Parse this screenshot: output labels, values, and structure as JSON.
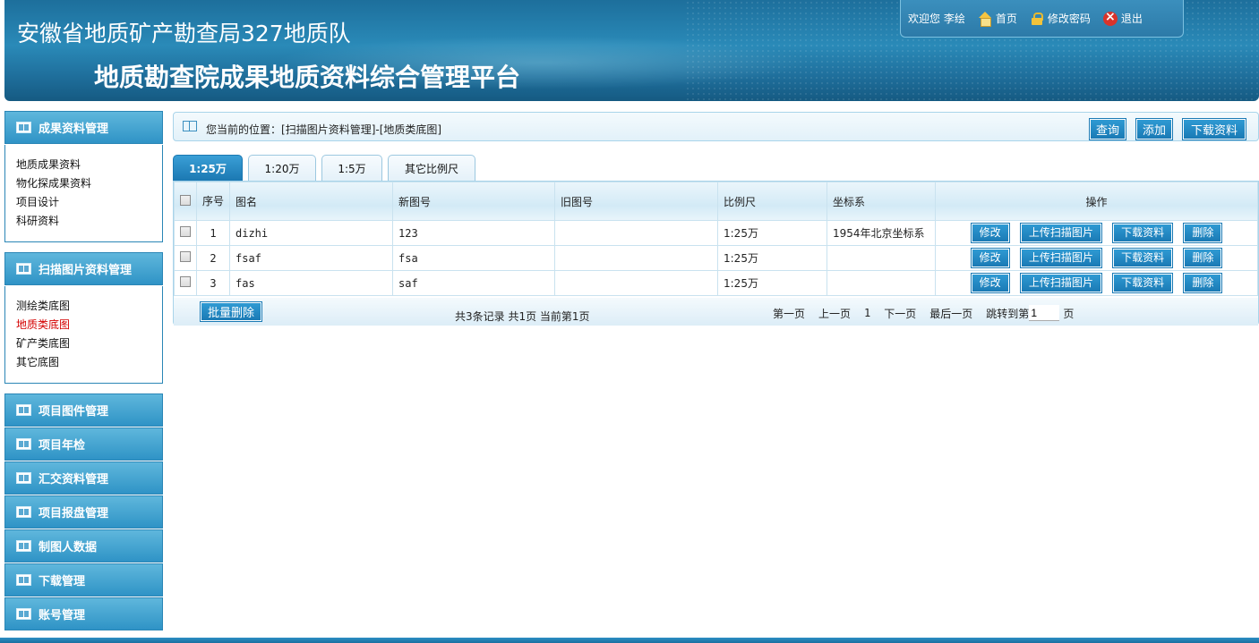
{
  "header": {
    "title_line1": "安徽省地质矿产勘查局327地质队",
    "title_line2": "地质勘查院成果地质资料综合管理平台"
  },
  "userbar": {
    "welcome": "欢迎您",
    "username": "李绘",
    "home_label": "首页",
    "change_password_label": "修改密码",
    "logout_label": "退出"
  },
  "sidebar": {
    "sections": [
      {
        "title": "成果资料管理",
        "items": [
          "地质成果资料",
          "物化探成果资料",
          "项目设计",
          "科研资料"
        ]
      },
      {
        "title": "扫描图片资料管理",
        "items": [
          "测绘类底图",
          "地质类底图",
          "矿产类底图",
          "其它底图"
        ],
        "active_index": 1
      }
    ],
    "collapsed": [
      "项目图件管理",
      "项目年检",
      "汇交资料管理",
      "项目报盘管理",
      "制图人数据",
      "下载管理",
      "账号管理"
    ]
  },
  "breadcrumb": {
    "prefix": "您当前的位置：",
    "path": "[扫描图片资料管理]-[地质类底图]"
  },
  "toolbar": {
    "query_label": "查询",
    "add_label": "添加",
    "download_label": "下载资料"
  },
  "tabs": [
    "1:25万",
    "1:20万",
    "1:5万",
    "其它比例尺"
  ],
  "active_tab": 0,
  "table": {
    "columns": [
      "序号",
      "图名",
      "新图号",
      "旧图号",
      "比例尺",
      "坐标系",
      "操作"
    ],
    "rows": [
      {
        "index": "1",
        "name": "dizhi",
        "new_no": "123",
        "old_no": "",
        "scale": "1:25万",
        "coord": "1954年北京坐标系"
      },
      {
        "index": "2",
        "name": "fsaf",
        "new_no": "fsa",
        "old_no": "",
        "scale": "1:25万",
        "coord": ""
      },
      {
        "index": "3",
        "name": "fas",
        "new_no": "saf",
        "old_no": "",
        "scale": "1:25万",
        "coord": ""
      }
    ],
    "row_actions": [
      "修改",
      "上传扫描图片",
      "下载资料",
      "删除"
    ]
  },
  "footer": {
    "batch_delete_label": "批量删除",
    "summary": "共3条记录  共1页  当前第1页",
    "first_label": "第一页",
    "prev_label": "上一页",
    "current_page": "1",
    "next_label": "下一页",
    "last_label": "最后一页",
    "jump_prefix": "跳转到第",
    "jump_value": "1",
    "jump_suffix": "页"
  },
  "colors": {
    "accent": "#1a7ab5",
    "active_link": "#d40000"
  }
}
